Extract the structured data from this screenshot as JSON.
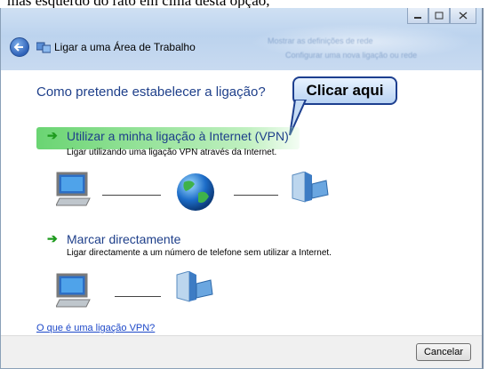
{
  "overlay_text": "mas esquerdo do rato em cima desta opção,",
  "window": {
    "title": "Ligar a uma Área de Trabalho",
    "blurred_lines": [
      "Mostrar as definições de rede",
      "Configurar uma nova ligação ou rede"
    ],
    "question": "Como pretende estabelecer a ligação?",
    "callout": "Clicar aqui",
    "options": [
      {
        "title": "Utilizar a minha ligação à Internet (VPN)",
        "description": "Ligar utilizando uma ligação VPN através da Internet.",
        "highlighted": true
      },
      {
        "title": "Marcar directamente",
        "description": "Ligar directamente a um número de telefone sem utilizar a Internet.",
        "highlighted": false
      }
    ],
    "help_link": "O que é uma ligação VPN?",
    "cancel_label": "Cancelar"
  },
  "icons": {
    "back": "back-arrow-icon",
    "app": "network-icon",
    "computer": "computer-icon",
    "globe": "globe-icon",
    "server": "server-icon",
    "option_arrow": "green-arrow-icon"
  },
  "colors": {
    "title_blue": "#1e3f8a",
    "highlight_green": "#50cd5a",
    "link_blue": "#1d48c8",
    "callout_border": "#1d3f8f"
  }
}
